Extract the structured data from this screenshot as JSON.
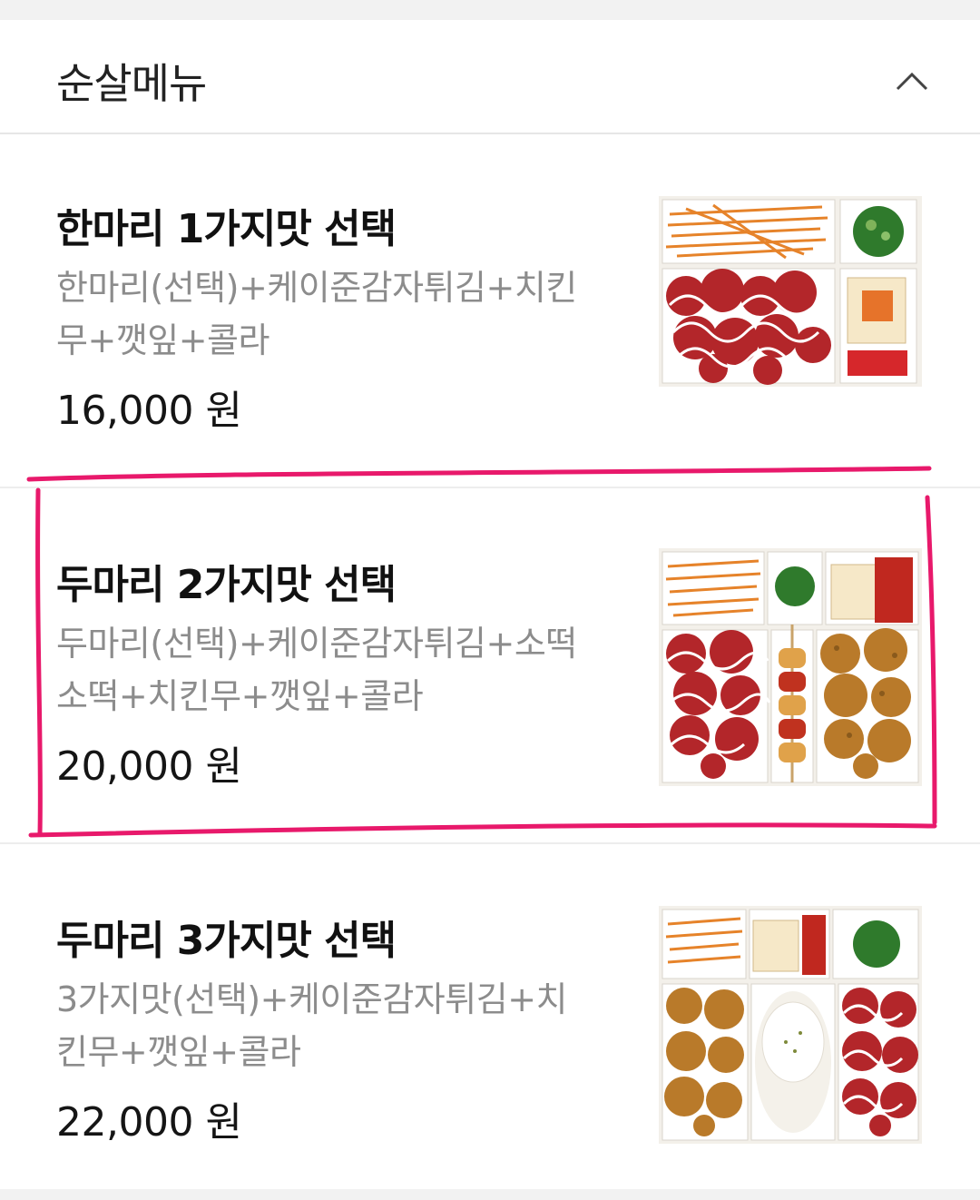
{
  "section": {
    "title": "순살메뉴",
    "toggle_icon": "chevron-up-icon"
  },
  "menu_items": [
    {
      "name": "한마리 1가지맛 선택",
      "description": "한마리(선택)+케이준감자튀김+치킨무+깻잎+콜라",
      "price": "16,000 원",
      "image_alt": "한마리 1가지맛 세트 사진"
    },
    {
      "name": "두마리 2가지맛 선택",
      "description": "두마리(선택)+케이준감자튀김+소떡소떡+치킨무+깻잎+콜라",
      "price": "20,000 원",
      "image_alt": "두마리 2가지맛 세트 사진"
    },
    {
      "name": "두마리 3가지맛 선택",
      "description": "3가지맛(선택)+케이준감자튀김+치킨무+깻잎+콜라",
      "price": "22,000 원",
      "image_alt": "두마리 3가지맛 세트 사진"
    }
  ],
  "colors": {
    "highlight": "#e8196b",
    "sauce": "#b3262a",
    "fries": "#e6832a",
    "fried_chicken": "#b97a2a",
    "green_onion": "#2f7a2c"
  }
}
